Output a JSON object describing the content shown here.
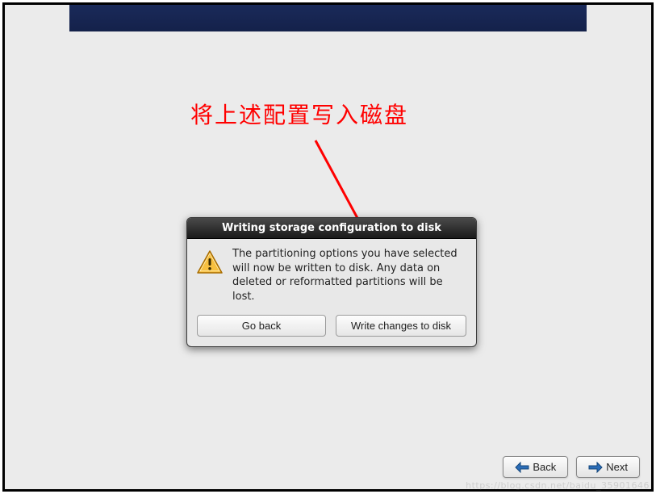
{
  "annotation": {
    "text": "将上述配置写入磁盘"
  },
  "dialog": {
    "title": "Writing storage configuration to disk",
    "body": "The partitioning options you have selected will now be written to disk.  Any data on deleted or reformatted partitions will be lost.",
    "go_back_label": "Go back",
    "write_label": "Write changes to disk"
  },
  "nav": {
    "back_label": "Back",
    "next_label": "Next"
  },
  "watermark": "https://blog.csdn.net/baidu_35901646"
}
